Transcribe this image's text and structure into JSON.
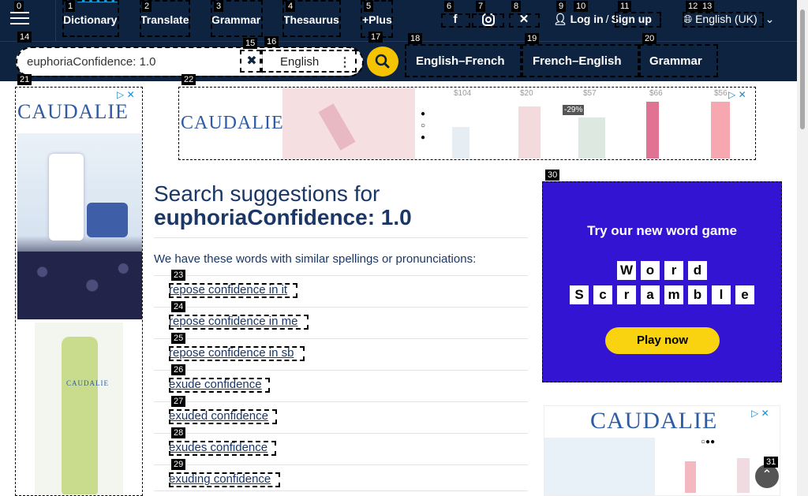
{
  "header": {
    "nav": [
      "Dictionary",
      "Translate",
      "Grammar",
      "Thesaurus",
      "+Plus"
    ],
    "login": "Log in",
    "slash": "/",
    "signup": "Sign up",
    "language": "English (UK)"
  },
  "search": {
    "value": "euphoriaConfidence: 1.0",
    "dictionary": "English"
  },
  "tabs": [
    "English–French",
    "French–English",
    "Grammar"
  ],
  "ads": {
    "brand": "CAUDALIE",
    "prices": [
      "$104",
      "$20",
      "$57",
      "$66",
      "$56"
    ],
    "discount": "-29%",
    "game_title": "Try our new word game",
    "game_word1": "Word",
    "game_word2": "Scramble",
    "game_button": "Play now"
  },
  "main": {
    "heading_prefix": "Search suggestions for",
    "heading_query": "euphoriaConfidence: 1.0",
    "intro": "We have these words with similar spellings or pronunciations:",
    "suggestions": [
      "repose confidence in it",
      "repose confidence in me",
      "repose confidence in sb",
      "exude confidence",
      "exuded confidence",
      "exudes confidence",
      "exuding confidence"
    ]
  },
  "markers": [
    "0",
    "1",
    "2",
    "3",
    "4",
    "5",
    "6",
    "7",
    "8",
    "9",
    "10",
    "11",
    "12",
    "13",
    "14",
    "15",
    "16",
    "17",
    "18",
    "19",
    "20",
    "21",
    "22",
    "23",
    "24",
    "25",
    "26",
    "27",
    "28",
    "29",
    "30",
    "31"
  ],
  "colors": {
    "navy": "#0e2340",
    "accent": "#f6c301",
    "link": "#1a3766",
    "game_bg": "#3314d2"
  }
}
